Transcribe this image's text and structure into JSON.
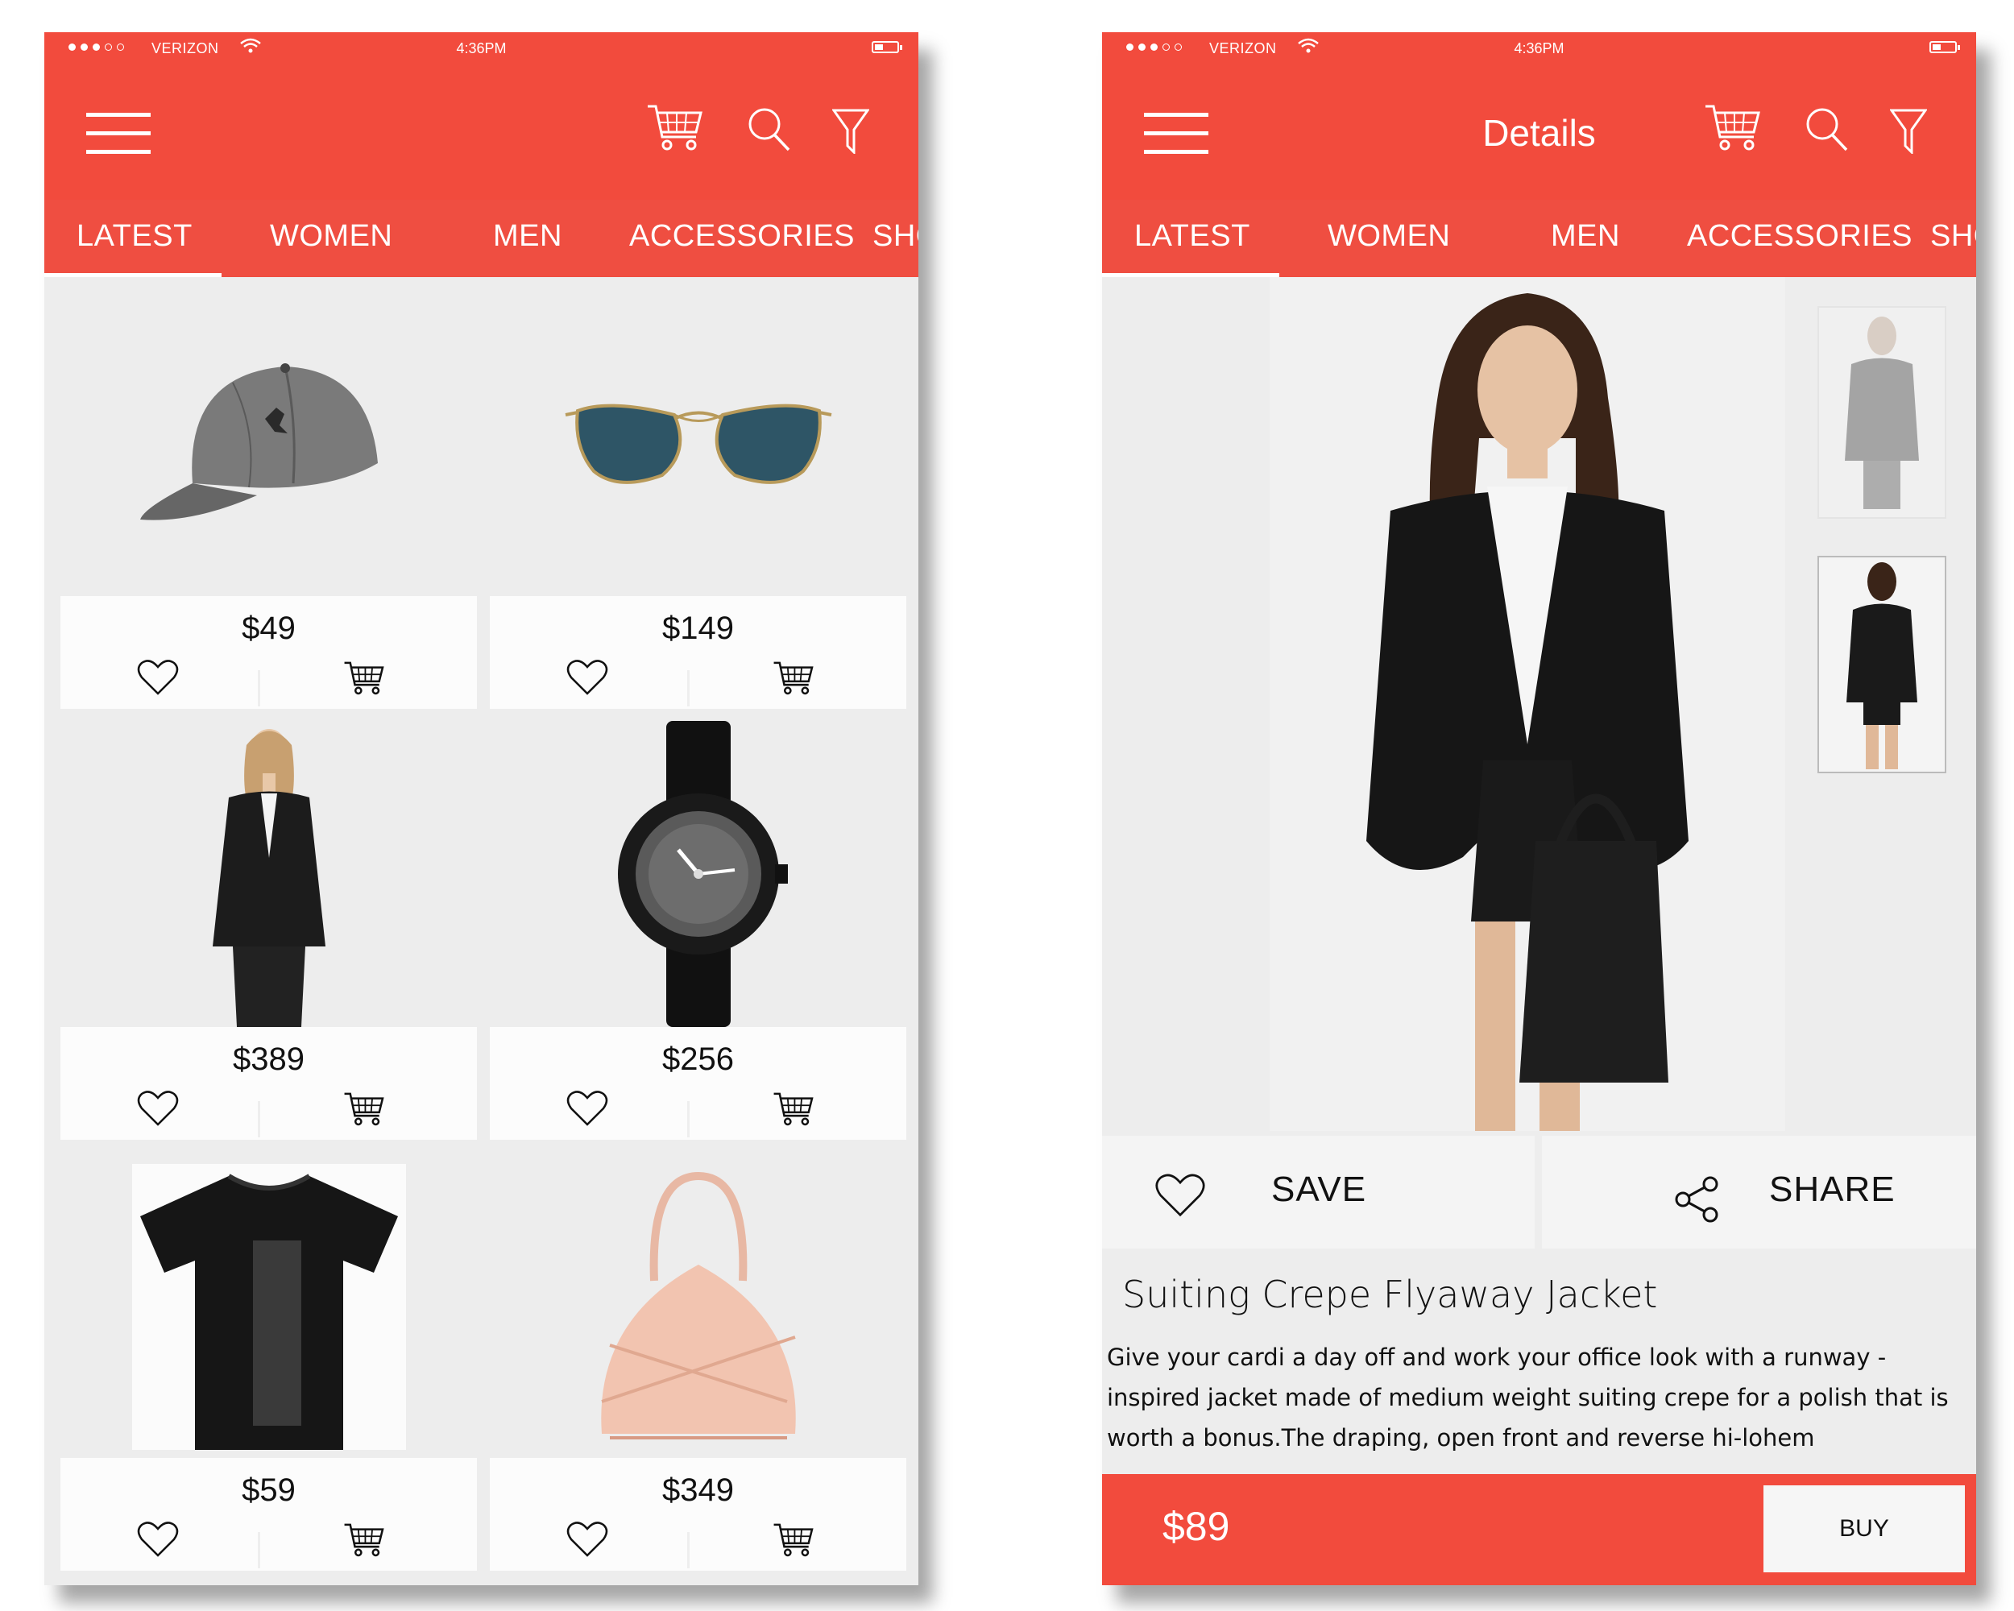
{
  "status_bar": {
    "carrier": "VERIZON",
    "time": "4:36PM"
  },
  "tabs": [
    "LATEST",
    "WOMEN",
    "MEN",
    "ACCESSORIES",
    "SHO"
  ],
  "grid": {
    "products": [
      {
        "name": "cap",
        "price": "$49"
      },
      {
        "name": "sunglasses",
        "price": "$149"
      },
      {
        "name": "blazer",
        "price": "$389"
      },
      {
        "name": "watch",
        "price": "$256"
      },
      {
        "name": "t-shirt",
        "price": "$59"
      },
      {
        "name": "handbag",
        "price": "$349"
      }
    ]
  },
  "details": {
    "title": "Details",
    "save_label": "SAVE",
    "share_label": "SHARE",
    "product_title": "Suiting Crepe Flyaway Jacket",
    "description": "Give your cardi a day off and work your office look with a runway -inspired jacket made of medium weight suiting crepe for a polish that is worth a bonus.The draping, open front and reverse hi-lohem",
    "price": "$89",
    "buy_label": "BUY"
  },
  "colors": {
    "accent": "#f24b3d",
    "tab_bar": "#ef4e41",
    "card": "#f6f6f6"
  },
  "icons": [
    "menu-icon",
    "cart-icon",
    "search-icon",
    "filter-icon",
    "heart-icon",
    "share-icon",
    "wifi-icon",
    "battery-icon"
  ]
}
